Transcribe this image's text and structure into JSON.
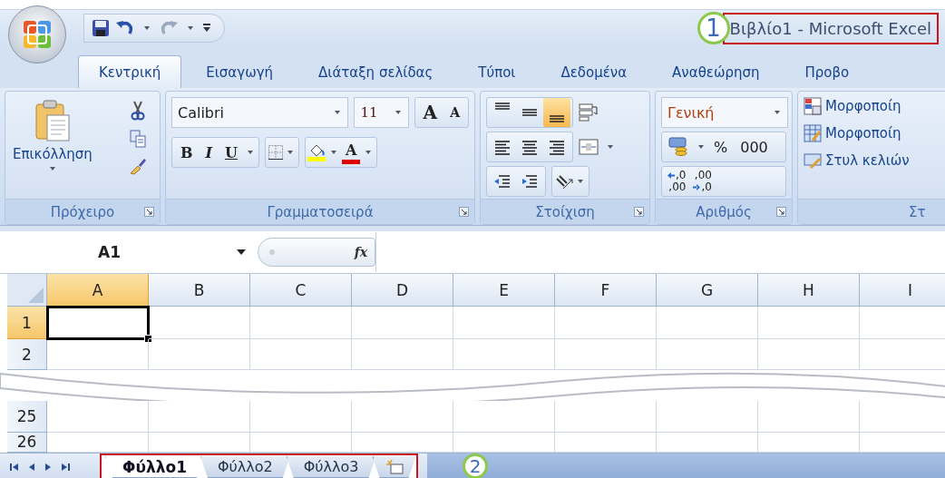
{
  "window": {
    "title": "Βιβλίο1 - Microsoft Excel",
    "callout": "1"
  },
  "tabs": [
    {
      "label": "Κεντρική",
      "selected": true
    },
    {
      "label": "Εισαγωγή",
      "selected": false
    },
    {
      "label": "Διάταξη σελίδας",
      "selected": false
    },
    {
      "label": "Τύποι",
      "selected": false
    },
    {
      "label": "Δεδομένα",
      "selected": false
    },
    {
      "label": "Αναθεώρηση",
      "selected": false
    },
    {
      "label": "Προβο",
      "selected": false
    }
  ],
  "ribbon": {
    "clipboard": {
      "label": "Πρόχειρο",
      "paste": "Επικόλληση"
    },
    "font": {
      "label": "Γραμματοσειρά",
      "font_name": "Calibri",
      "font_size": "11",
      "grow": "A",
      "shrink": "A",
      "bold": "B",
      "italic": "I",
      "underline": "U",
      "font_color": "A"
    },
    "alignment": {
      "label": "Στοίχιση",
      "vertical_align": [
        {
          "selected": false
        },
        {
          "selected": false
        },
        {
          "selected": true
        }
      ]
    },
    "number": {
      "label": "Αριθμός",
      "format": "Γενική",
      "percent": "%",
      "thousands": "000",
      "decimals": [
        {
          "top": ",0",
          "bottom": ",00"
        },
        {
          "top": ",00",
          "bottom": ",0"
        }
      ]
    },
    "styles": {
      "label": "Στ",
      "items": [
        "Μορφοποίη",
        "Μορφοποίη",
        "Στυλ κελιών"
      ]
    }
  },
  "formula_bar": {
    "name_box": "A1",
    "fx": "fx"
  },
  "sheet": {
    "columns": [
      {
        "label": "A",
        "selected": true
      },
      {
        "label": "B",
        "selected": false
      },
      {
        "label": "C",
        "selected": false
      },
      {
        "label": "D",
        "selected": false
      },
      {
        "label": "E",
        "selected": false
      },
      {
        "label": "F",
        "selected": false
      },
      {
        "label": "G",
        "selected": false
      },
      {
        "label": "H",
        "selected": false
      },
      {
        "label": "I",
        "selected": false
      }
    ],
    "rows": [
      {
        "kind": "row",
        "label": "1",
        "selected": true
      },
      {
        "kind": "row",
        "label": "2",
        "selected": false
      },
      {
        "kind": "break"
      },
      {
        "kind": "row",
        "label": "25",
        "selected": false
      },
      {
        "kind": "row",
        "label": "26",
        "selected": false
      }
    ]
  },
  "sheet_tabs": {
    "callout": "2",
    "tabs": [
      {
        "label": "Φύλλο1",
        "selected": true
      },
      {
        "label": "Φύλλο2",
        "selected": false
      },
      {
        "label": "Φύλλο3",
        "selected": false
      }
    ]
  }
}
